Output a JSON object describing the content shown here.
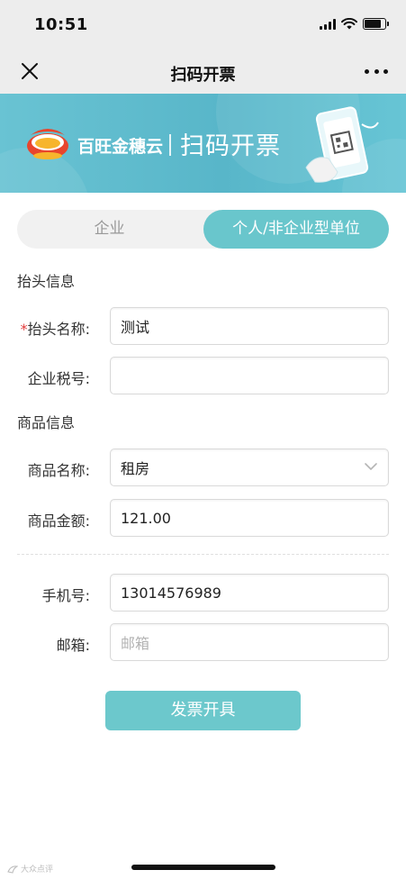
{
  "status_bar": {
    "time": "10:51"
  },
  "nav": {
    "title": "扫码开票"
  },
  "banner": {
    "brand": "百旺金穗云",
    "title": "扫码开票"
  },
  "tabs": [
    {
      "label": "企业",
      "active": false
    },
    {
      "label": "个人/非企业型单位",
      "active": true
    }
  ],
  "invoice_header": {
    "section_title": "抬头信息",
    "name_required_mark": "*",
    "name_label": "抬头名称:",
    "name_value": "测试",
    "tax_label": "企业税号:",
    "tax_value": ""
  },
  "goods": {
    "section_title": "商品信息",
    "name_label": "商品名称:",
    "name_value": "租房",
    "amount_label": "商品金额:",
    "amount_value": "121.00"
  },
  "contact": {
    "phone_label": "手机号:",
    "phone_value": "13014576989",
    "email_label": "邮箱:",
    "email_placeholder": "邮箱"
  },
  "submit_label": "发票开具",
  "watermark": "大众点评",
  "colors": {
    "accent": "#69c6cc",
    "banner": "#5fbccd",
    "required": "#e23b3b"
  }
}
